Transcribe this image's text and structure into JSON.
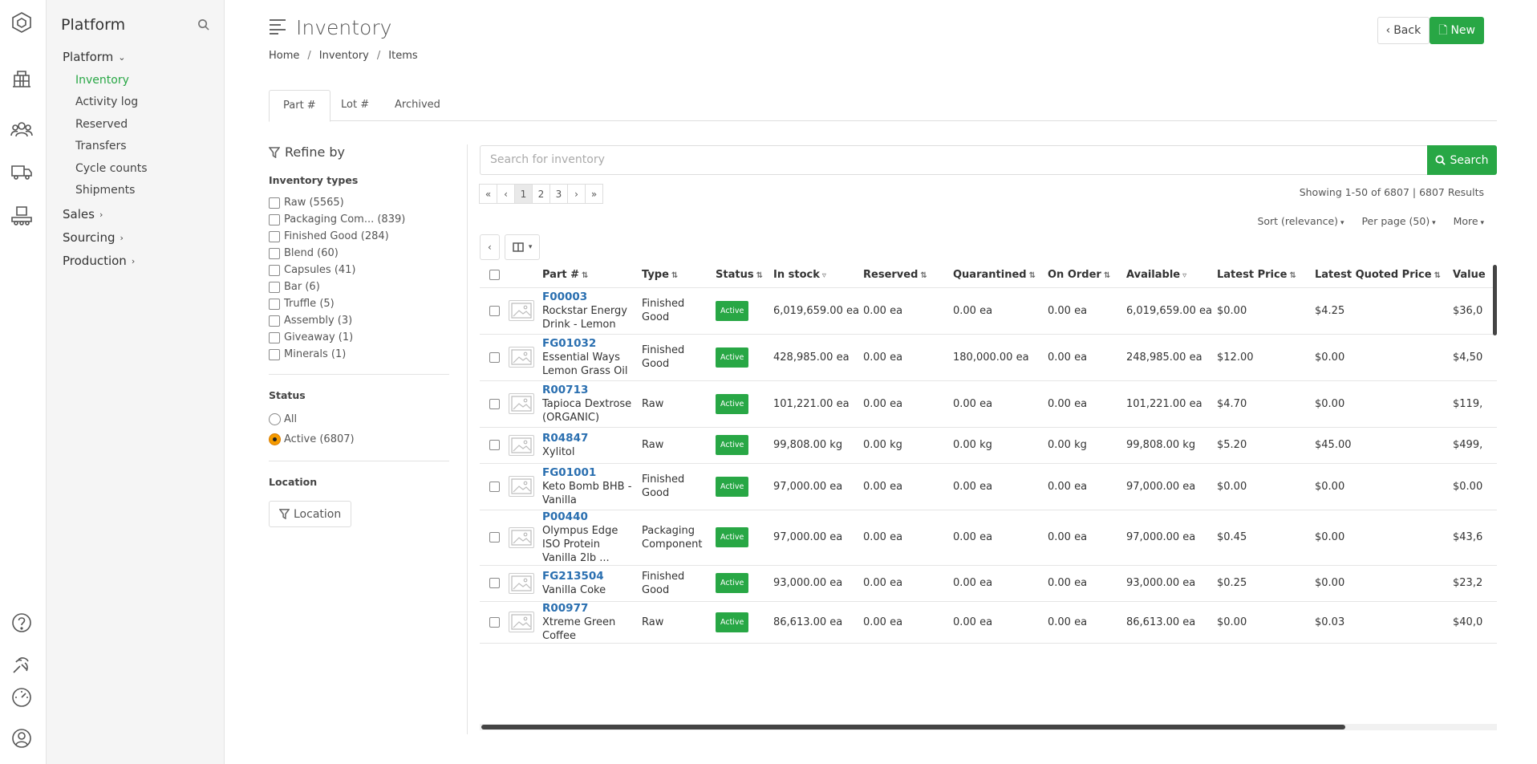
{
  "app": {
    "title": "Platform"
  },
  "nav": {
    "groups": [
      {
        "label": "Platform",
        "expanded": true
      },
      {
        "label": "Sales"
      },
      {
        "label": "Sourcing"
      },
      {
        "label": "Production"
      }
    ],
    "items": [
      "Inventory",
      "Activity log",
      "Reserved",
      "Transfers",
      "Cycle counts",
      "Shipments"
    ],
    "active_item": "Inventory"
  },
  "page": {
    "title": "Inventory",
    "back_label": "Back",
    "new_label": "New",
    "breadcrumb": [
      "Home",
      "Inventory",
      "Items"
    ],
    "tabs": [
      "Part #",
      "Lot #",
      "Archived"
    ],
    "active_tab": "Part #"
  },
  "refine": {
    "title": "Refine by",
    "inventory_types_label": "Inventory types",
    "inventory_types": [
      "Raw (5565)",
      "Packaging Com... (839)",
      "Finished Good (284)",
      "Blend (60)",
      "Capsules (41)",
      "Bar (6)",
      "Truffle (5)",
      "Assembly (3)",
      "Giveaway (1)",
      "Minerals (1)"
    ],
    "status_label": "Status",
    "status_options": [
      "All",
      "Active (6807)"
    ],
    "status_selected": "Active (6807)",
    "location_label": "Location",
    "location_button": "Location"
  },
  "search": {
    "placeholder": "Search for inventory",
    "button": "Search"
  },
  "pagination": {
    "pages": [
      "«",
      "‹",
      "1",
      "2",
      "3",
      "›",
      "»"
    ],
    "current": "1",
    "showing": "Showing 1-50 of 6807 | 6807 Results"
  },
  "options": {
    "sort": "Sort (relevance)",
    "per_page": "Per page (50)",
    "more": "More"
  },
  "table": {
    "columns": [
      "Part #",
      "Type",
      "Status",
      "In stock",
      "Reserved",
      "Quarantined",
      "On Order",
      "Available",
      "Latest Price",
      "Latest Quoted Price",
      "Value"
    ],
    "rows": [
      {
        "part": "F00003",
        "name": "Rockstar Energy Drink - Lemon",
        "type": "Finished Good",
        "status": "Active",
        "in_stock": "6,019,659.00 ea",
        "reserved": "0.00 ea",
        "quarantined": "0.00 ea",
        "on_order": "0.00 ea",
        "available": "6,019,659.00 ea",
        "latest_price": "$0.00",
        "quoted_price": "$4.25",
        "value": "$36,0"
      },
      {
        "part": "FG01032",
        "name": "Essential Ways Lemon Grass Oil",
        "type": "Finished Good",
        "status": "Active",
        "in_stock": "428,985.00 ea",
        "reserved": "0.00 ea",
        "quarantined": "180,000.00 ea",
        "on_order": "0.00 ea",
        "available": "248,985.00 ea",
        "latest_price": "$12.00",
        "quoted_price": "$0.00",
        "value": "$4,50"
      },
      {
        "part": "R00713",
        "name": "Tapioca Dextrose (ORGANIC)",
        "type": "Raw",
        "status": "Active",
        "in_stock": "101,221.00 ea",
        "reserved": "0.00 ea",
        "quarantined": "0.00 ea",
        "on_order": "0.00 ea",
        "available": "101,221.00 ea",
        "latest_price": "$4.70",
        "quoted_price": "$0.00",
        "value": "$119,"
      },
      {
        "part": "R04847",
        "name": "Xylitol",
        "type": "Raw",
        "status": "Active",
        "in_stock": "99,808.00 kg",
        "reserved": "0.00 kg",
        "quarantined": "0.00 kg",
        "on_order": "0.00 kg",
        "available": "99,808.00 kg",
        "latest_price": "$5.20",
        "quoted_price": "$45.00",
        "value": "$499,"
      },
      {
        "part": "FG01001",
        "name": "Keto Bomb BHB - Vanilla",
        "type": "Finished Good",
        "status": "Active",
        "in_stock": "97,000.00 ea",
        "reserved": "0.00 ea",
        "quarantined": "0.00 ea",
        "on_order": "0.00 ea",
        "available": "97,000.00 ea",
        "latest_price": "$0.00",
        "quoted_price": "$0.00",
        "value": "$0.00"
      },
      {
        "part": "P00440",
        "name": "Olympus Edge ISO Protein Vanilla 2lb ...",
        "type": "Packaging Component",
        "status": "Active",
        "in_stock": "97,000.00 ea",
        "reserved": "0.00 ea",
        "quarantined": "0.00 ea",
        "on_order": "0.00 ea",
        "available": "97,000.00 ea",
        "latest_price": "$0.45",
        "quoted_price": "$0.00",
        "value": "$43,6"
      },
      {
        "part": "FG213504",
        "name": "Vanilla Coke",
        "type": "Finished Good",
        "status": "Active",
        "in_stock": "93,000.00 ea",
        "reserved": "0.00 ea",
        "quarantined": "0.00 ea",
        "on_order": "0.00 ea",
        "available": "93,000.00 ea",
        "latest_price": "$0.25",
        "quoted_price": "$0.00",
        "value": "$23,2"
      },
      {
        "part": "R00977",
        "name": "Xtreme Green Coffee",
        "type": "Raw",
        "status": "Active",
        "in_stock": "86,613.00 ea",
        "reserved": "0.00 ea",
        "quarantined": "0.00 ea",
        "on_order": "0.00 ea",
        "available": "86,613.00 ea",
        "latest_price": "$0.00",
        "quoted_price": "$0.03",
        "value": "$40,0"
      }
    ]
  },
  "colors": {
    "accent": "#28a745",
    "link": "#2a6fb0"
  }
}
